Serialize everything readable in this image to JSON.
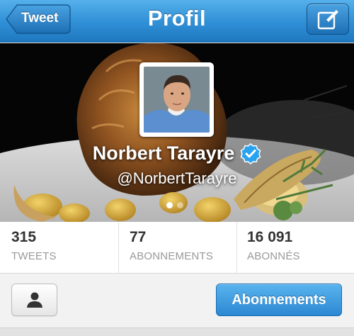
{
  "navbar": {
    "title": "Profil",
    "back_label": "Tweet",
    "compose_icon": "compose-icon",
    "color": "#2f8fd6"
  },
  "profile": {
    "display_name": "Norbert Tarayre",
    "handle": "@NorbertTarayre",
    "verified": true,
    "verified_color": "#2aa3ef",
    "banner_pages": 2,
    "banner_active_page": 1
  },
  "stats": [
    {
      "value": "315",
      "label": "TWEETS"
    },
    {
      "value": "77",
      "label": "ABONNEMENTS"
    },
    {
      "value": "16 091",
      "label": "ABONNÉS"
    }
  ],
  "actions": {
    "person_icon": "person-icon",
    "follow_label": "Abonnements",
    "accent": "#2d88d3"
  }
}
